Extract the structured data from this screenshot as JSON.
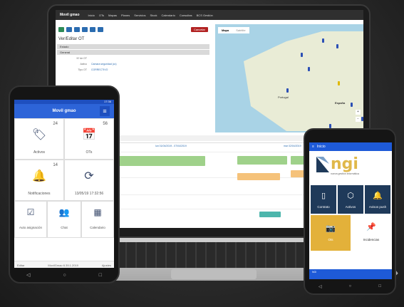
{
  "web": {
    "brand": "Movil gmao",
    "nav": [
      "Inicio",
      "OTs",
      "Mapas",
      "Planes",
      "Servicios",
      "Stock",
      "Calendario",
      "Consultas",
      "BCS Gestión"
    ],
    "form_title": "Ver/Editar OT",
    "sections": [
      "Estado",
      "General"
    ],
    "fields": [
      {
        "label": "Nº de OT",
        "value": ""
      },
      {
        "label": "Activo",
        "value": "Camara seguridad (cc)"
      },
      {
        "label": "Tipo OT",
        "value": "CORRECTIVO"
      }
    ],
    "cancel_label": "Cancelar",
    "map_tabs": [
      "Mapa",
      "Satélite"
    ],
    "map_labels": {
      "portugal": "Portugal",
      "espana": "España"
    },
    "zoom_in": "+",
    "zoom_out": "−",
    "calendar_toolbar": "4/4 Número de ots",
    "calendar_dates": [
      "lun 01/04/2019 - 07/04/2019",
      "mar 02/04/2019"
    ]
  },
  "phone_left": {
    "time": "17:36",
    "brand": "Movil gmao",
    "tiles": [
      {
        "name": "activos",
        "count": "24",
        "label": "Activos",
        "icon": "tags-icon"
      },
      {
        "name": "ots",
        "count": "56",
        "label": "OTs",
        "icon": "calendar-icon"
      },
      {
        "name": "notificaciones",
        "count": "14",
        "label": "Notificaciones",
        "icon": "bell-icon"
      },
      {
        "name": "sync",
        "count": "",
        "label": "13/05/19 17:32:56",
        "icon": "refresh-icon"
      },
      {
        "name": "auto-asignacion",
        "count": "",
        "label": "Auto asignación",
        "icon": "checkbox-icon"
      },
      {
        "name": "chat",
        "count": "",
        "label": "Chat",
        "icon": "users-icon"
      },
      {
        "name": "calendario",
        "count": "",
        "label": "Calendario",
        "icon": "calendar-grid-icon"
      }
    ],
    "footer_left": "Editar",
    "footer_mid": "MovilGmao 6.39.1.2019",
    "footer_right": "Ajustes"
  },
  "phone_right": {
    "header": "Inicio",
    "logo": "ngi",
    "logo_sub": "nueva gestión informática",
    "tiles": [
      {
        "label": "Contrato",
        "icon": "document-icon",
        "color": "#1f3a5a"
      },
      {
        "label": "Activos",
        "icon": "box-icon",
        "color": "#1f3a5a"
      },
      {
        "label": "Avisos push",
        "icon": "bell-icon",
        "color": "#1f3a5a"
      },
      {
        "label": "Ots",
        "icon": "camera-icon",
        "color": "#e3b13a"
      },
      {
        "label": "Incidencias",
        "icon": "pushpin-icon",
        "color": "#ffffff"
      }
    ],
    "footer": "NGI"
  },
  "colors": {
    "accent_blue": "#2d64d8",
    "gold": "#e3b13a",
    "navy": "#1f3a5a"
  }
}
